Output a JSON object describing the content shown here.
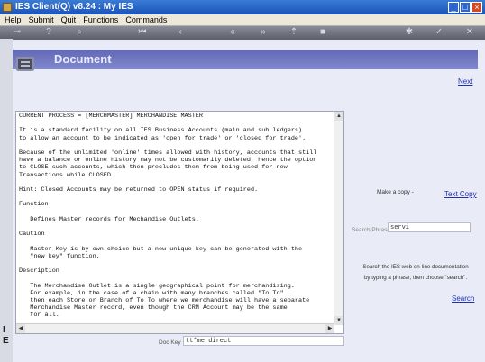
{
  "window": {
    "title": "IES Client(Q) v8.24 : My IES"
  },
  "menu": {
    "items": [
      "Help",
      "Submit",
      "Quit",
      "Functions",
      "Commands"
    ]
  },
  "left_strip": {
    "letters": [
      "I",
      "E"
    ]
  },
  "header": {
    "title": "Document"
  },
  "nav": {
    "next_label": "Next"
  },
  "document": {
    "lines": [
      "CURRENT PROCESS = [MERCHMASTER] MERCHANDISE MASTER",
      "",
      "It is a standard facility on all IES Business Accounts (main and sub ledgers)",
      "to allow an account to be indicated as 'open for trade' or 'closed for trade'.",
      "",
      "Because of the unlimited 'online' times allowed with history, accounts that still",
      "have a balance or online history may not be customarily deleted, hence the option",
      "to CLOSE such accounts, which then precludes them from being used for new",
      "Transactions while CLOSED.",
      "",
      "Hint: Closed Accounts may be returned to OPEN status if required.",
      "",
      "Function",
      "",
      "   Defines Master records for Mechandise Outlets.",
      "",
      "Caution",
      "",
      "   Master Key is by own choice but a new unique key can be generated with the",
      "   \"new key\" function.",
      "",
      "Description",
      "",
      "   The Merchandise Outlet is a single geographical point for merchandising.",
      "   For example, in the case of a chain with many branches called \"To To\"",
      "   then each Store or Branch of To To where we merchandise will have a separate",
      "   Merchandise Master record, even though the CRM Account may be the same",
      "   for all."
    ]
  },
  "doc_key": {
    "label": "Doc Key",
    "value": "tt*merdirect"
  },
  "copy": {
    "prompt": "Make a copy -",
    "link_label": "Text Copy"
  },
  "search": {
    "label": "Search Phrase",
    "value": "servi",
    "help_lines": [
      "Search the IES web on-line documentation",
      "by typing a phrase, then choose \"search\"."
    ],
    "link_label": "Search"
  },
  "colors": {
    "header_band": "#6a70bd",
    "link": "#1d2fb5",
    "titlebar": "#2a63c8"
  }
}
